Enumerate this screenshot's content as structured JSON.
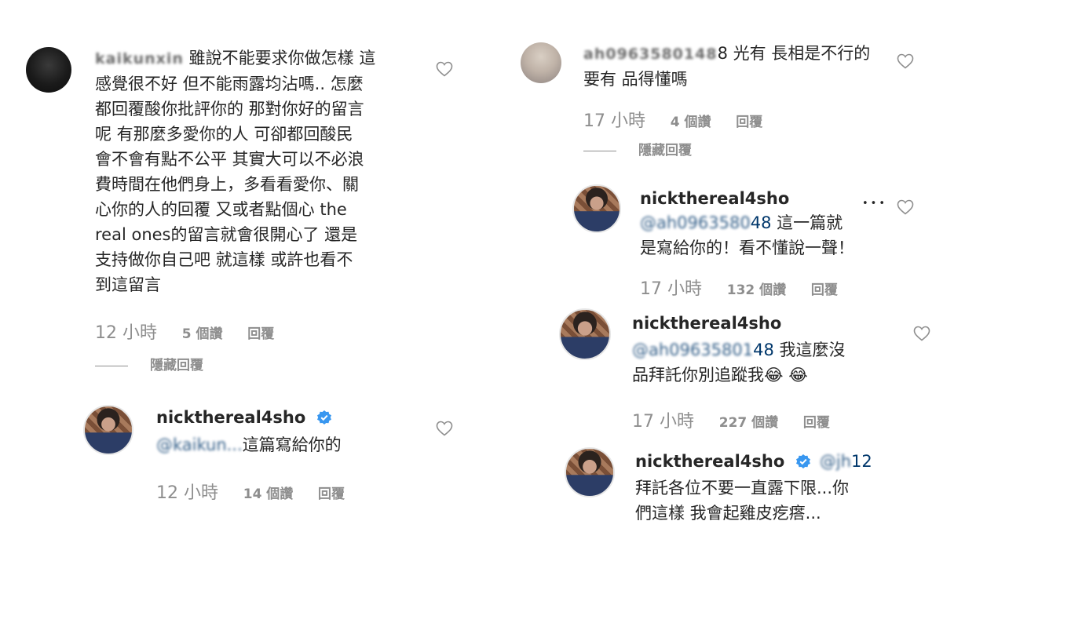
{
  "left": {
    "comment": {
      "username": "kaikunxin",
      "text_lines": [
        "雖說不能要求你做怎樣 這",
        "感覺很不好 但不能雨露均沾嗎.. 怎麼",
        "都回覆酸你批評你的 那對你好的留言",
        "呢 有那麼多愛你的人 可卻都回酸民",
        "會不會有點不公平 其實大可以不必浪",
        "費時間在他們身上，多看看愛你、關",
        "心你的人的回覆 又或者點個心 the",
        "real ones的留言就會很開心了 還是",
        "支持做你自己吧 就這樣 或許也看不",
        "到這留言"
      ],
      "time": "12 小時",
      "likes": "5 個讚",
      "reply": "回覆",
      "hide_replies": "隱藏回覆"
    },
    "reply": {
      "username": "nickthereal4sho",
      "mention": "@kaikun...",
      "text": "這篇寫給你的",
      "time": "12 小時",
      "likes": "14 個讚",
      "reply": "回覆"
    }
  },
  "right": {
    "comment": {
      "username": "ah0963580148",
      "text_line1": "8 光有 長相是不行的",
      "text_line2": "要有 品得懂嗎",
      "time": "17 小時",
      "likes": "4 個讚",
      "reply": "回覆",
      "hide_replies": "隱藏回覆"
    },
    "reply1": {
      "username": "nickthereal4sho",
      "mention": "@ah0963580",
      "mention_end": "48",
      "text_line1": "這一篇就",
      "text_line2": "是寫給你的！看不懂說一聲！",
      "more": "•••",
      "time": "17 小時",
      "likes": "132 個讚",
      "reply": "回覆"
    },
    "reply2": {
      "username": "nickthereal4sho",
      "mention": "@ah09635801",
      "mention_end": "48",
      "text_line1": "我這麼沒",
      "text_line2": "品拜託你別追蹤我😂 😂",
      "time": "17 小時",
      "likes": "227 個讚",
      "reply": "回覆"
    },
    "reply3": {
      "username": "nickthereal4sho",
      "mention": "@jh",
      "mention_end": "12",
      "text_line1": "拜託各位不要一直露下限...你",
      "text_line2": "們這樣 我會起雞皮疙瘩..."
    }
  },
  "colors": {
    "text": "#262626",
    "meta": "#8e8e8e",
    "mention": "#00376b",
    "verified": "#3897f0"
  }
}
